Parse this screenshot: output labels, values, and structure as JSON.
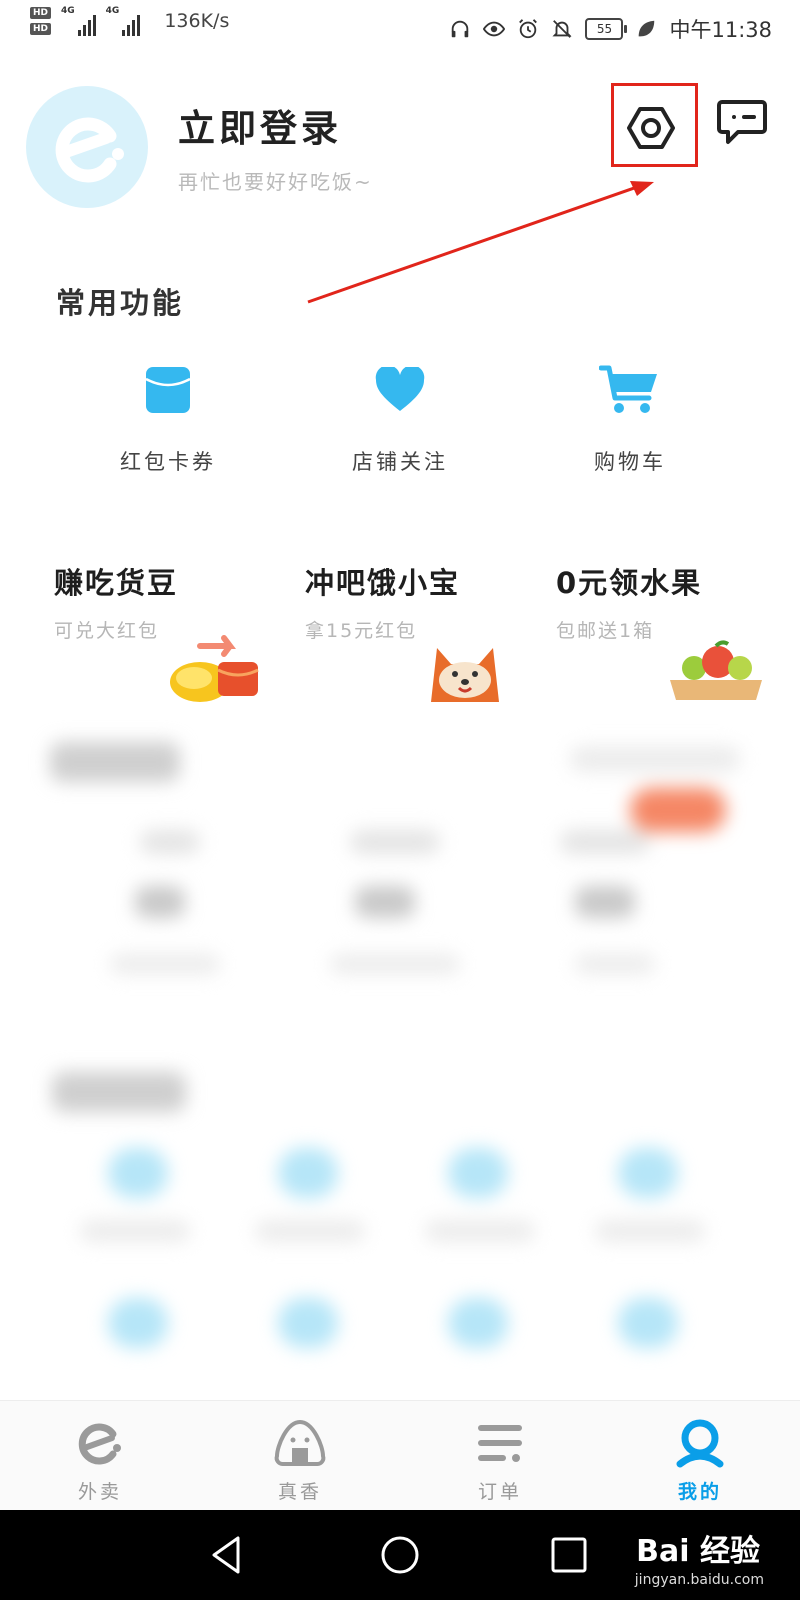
{
  "status_bar": {
    "hd1": "HD",
    "hd2": "HD",
    "net1": "4G",
    "net2": "4G",
    "speed": "136K/s",
    "battery": "55",
    "time": "中午11:38"
  },
  "profile": {
    "title": "立即登录",
    "subtitle": "再忙也要好好吃饭~"
  },
  "common_functions": {
    "title": "常用功能",
    "items": [
      {
        "label": "红包卡券",
        "icon": "red-packet-icon"
      },
      {
        "label": "店铺关注",
        "icon": "heart-icon"
      },
      {
        "label": "购物车",
        "icon": "shopping-cart-icon"
      }
    ]
  },
  "promos": [
    {
      "title": "赚吃货豆",
      "subtitle": "可兑大红包"
    },
    {
      "title": "冲吧饿小宝",
      "subtitle": "拿15元红包"
    },
    {
      "title": "0元领水果",
      "subtitle": "包邮送1箱"
    }
  ],
  "tabs": [
    {
      "label": "外卖",
      "icon": "eleme-logo-icon",
      "active": false
    },
    {
      "label": "真香",
      "icon": "onigiri-icon",
      "active": false
    },
    {
      "label": "订单",
      "icon": "list-icon",
      "active": false
    },
    {
      "label": "我的",
      "icon": "person-icon",
      "active": true
    }
  ],
  "watermark": {
    "text": "Bai 经验",
    "url_text": "jingyan.baidu.com"
  },
  "colors": {
    "accent": "#0a9ee8",
    "icon_blue": "#35b8ef",
    "highlight_red": "#e1251b"
  }
}
